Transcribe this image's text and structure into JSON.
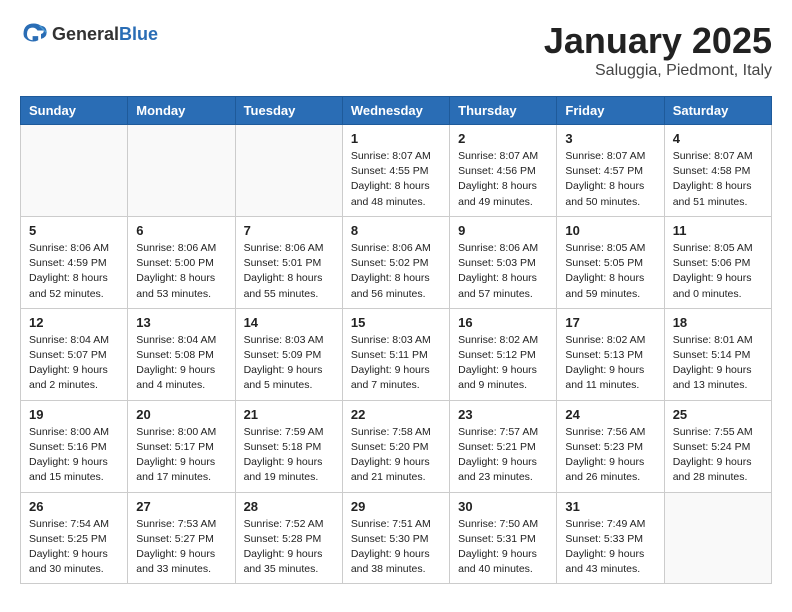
{
  "header": {
    "logo_general": "General",
    "logo_blue": "Blue",
    "month": "January 2025",
    "location": "Saluggia, Piedmont, Italy"
  },
  "weekdays": [
    "Sunday",
    "Monday",
    "Tuesday",
    "Wednesday",
    "Thursday",
    "Friday",
    "Saturday"
  ],
  "weeks": [
    [
      {
        "day": "",
        "info": ""
      },
      {
        "day": "",
        "info": ""
      },
      {
        "day": "",
        "info": ""
      },
      {
        "day": "1",
        "info": "Sunrise: 8:07 AM\nSunset: 4:55 PM\nDaylight: 8 hours\nand 48 minutes."
      },
      {
        "day": "2",
        "info": "Sunrise: 8:07 AM\nSunset: 4:56 PM\nDaylight: 8 hours\nand 49 minutes."
      },
      {
        "day": "3",
        "info": "Sunrise: 8:07 AM\nSunset: 4:57 PM\nDaylight: 8 hours\nand 50 minutes."
      },
      {
        "day": "4",
        "info": "Sunrise: 8:07 AM\nSunset: 4:58 PM\nDaylight: 8 hours\nand 51 minutes."
      }
    ],
    [
      {
        "day": "5",
        "info": "Sunrise: 8:06 AM\nSunset: 4:59 PM\nDaylight: 8 hours\nand 52 minutes."
      },
      {
        "day": "6",
        "info": "Sunrise: 8:06 AM\nSunset: 5:00 PM\nDaylight: 8 hours\nand 53 minutes."
      },
      {
        "day": "7",
        "info": "Sunrise: 8:06 AM\nSunset: 5:01 PM\nDaylight: 8 hours\nand 55 minutes."
      },
      {
        "day": "8",
        "info": "Sunrise: 8:06 AM\nSunset: 5:02 PM\nDaylight: 8 hours\nand 56 minutes."
      },
      {
        "day": "9",
        "info": "Sunrise: 8:06 AM\nSunset: 5:03 PM\nDaylight: 8 hours\nand 57 minutes."
      },
      {
        "day": "10",
        "info": "Sunrise: 8:05 AM\nSunset: 5:05 PM\nDaylight: 8 hours\nand 59 minutes."
      },
      {
        "day": "11",
        "info": "Sunrise: 8:05 AM\nSunset: 5:06 PM\nDaylight: 9 hours\nand 0 minutes."
      }
    ],
    [
      {
        "day": "12",
        "info": "Sunrise: 8:04 AM\nSunset: 5:07 PM\nDaylight: 9 hours\nand 2 minutes."
      },
      {
        "day": "13",
        "info": "Sunrise: 8:04 AM\nSunset: 5:08 PM\nDaylight: 9 hours\nand 4 minutes."
      },
      {
        "day": "14",
        "info": "Sunrise: 8:03 AM\nSunset: 5:09 PM\nDaylight: 9 hours\nand 5 minutes."
      },
      {
        "day": "15",
        "info": "Sunrise: 8:03 AM\nSunset: 5:11 PM\nDaylight: 9 hours\nand 7 minutes."
      },
      {
        "day": "16",
        "info": "Sunrise: 8:02 AM\nSunset: 5:12 PM\nDaylight: 9 hours\nand 9 minutes."
      },
      {
        "day": "17",
        "info": "Sunrise: 8:02 AM\nSunset: 5:13 PM\nDaylight: 9 hours\nand 11 minutes."
      },
      {
        "day": "18",
        "info": "Sunrise: 8:01 AM\nSunset: 5:14 PM\nDaylight: 9 hours\nand 13 minutes."
      }
    ],
    [
      {
        "day": "19",
        "info": "Sunrise: 8:00 AM\nSunset: 5:16 PM\nDaylight: 9 hours\nand 15 minutes."
      },
      {
        "day": "20",
        "info": "Sunrise: 8:00 AM\nSunset: 5:17 PM\nDaylight: 9 hours\nand 17 minutes."
      },
      {
        "day": "21",
        "info": "Sunrise: 7:59 AM\nSunset: 5:18 PM\nDaylight: 9 hours\nand 19 minutes."
      },
      {
        "day": "22",
        "info": "Sunrise: 7:58 AM\nSunset: 5:20 PM\nDaylight: 9 hours\nand 21 minutes."
      },
      {
        "day": "23",
        "info": "Sunrise: 7:57 AM\nSunset: 5:21 PM\nDaylight: 9 hours\nand 23 minutes."
      },
      {
        "day": "24",
        "info": "Sunrise: 7:56 AM\nSunset: 5:23 PM\nDaylight: 9 hours\nand 26 minutes."
      },
      {
        "day": "25",
        "info": "Sunrise: 7:55 AM\nSunset: 5:24 PM\nDaylight: 9 hours\nand 28 minutes."
      }
    ],
    [
      {
        "day": "26",
        "info": "Sunrise: 7:54 AM\nSunset: 5:25 PM\nDaylight: 9 hours\nand 30 minutes."
      },
      {
        "day": "27",
        "info": "Sunrise: 7:53 AM\nSunset: 5:27 PM\nDaylight: 9 hours\nand 33 minutes."
      },
      {
        "day": "28",
        "info": "Sunrise: 7:52 AM\nSunset: 5:28 PM\nDaylight: 9 hours\nand 35 minutes."
      },
      {
        "day": "29",
        "info": "Sunrise: 7:51 AM\nSunset: 5:30 PM\nDaylight: 9 hours\nand 38 minutes."
      },
      {
        "day": "30",
        "info": "Sunrise: 7:50 AM\nSunset: 5:31 PM\nDaylight: 9 hours\nand 40 minutes."
      },
      {
        "day": "31",
        "info": "Sunrise: 7:49 AM\nSunset: 5:33 PM\nDaylight: 9 hours\nand 43 minutes."
      },
      {
        "day": "",
        "info": ""
      }
    ]
  ]
}
